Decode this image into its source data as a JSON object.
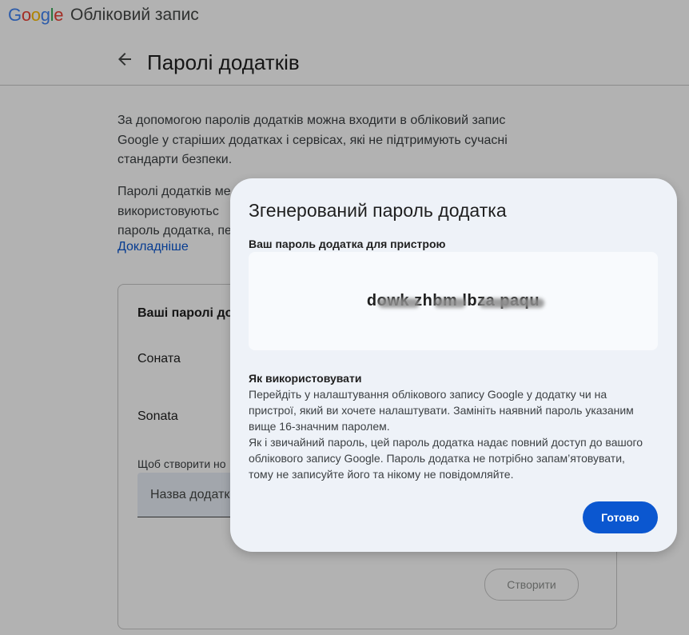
{
  "header": {
    "logo_letters": [
      "G",
      "o",
      "o",
      "g",
      "l",
      "e"
    ],
    "logo_colors": [
      "#4285f4",
      "#ea4335",
      "#fbbc05",
      "#4285f4",
      "#34a853",
      "#ea4335"
    ],
    "account_title": "Обліковий запис",
    "page_title": "Паролі додатків",
    "back_icon": "arrow-left-icon"
  },
  "intro": {
    "para1_lines": [
      "За допомогою паролів додатків можна входити в обліковий запис",
      "Google у старіших додатках і сервісах, які не підтримують сучасні",
      "стандарти безпеки."
    ],
    "para2_lines": [
      "Паролі додатків ме",
      "використовуютьс",
      "пароль додатка, пе"
    ],
    "learn_more": "Докладніше"
  },
  "card": {
    "title": "Ваші паролі до",
    "apps": [
      "Соната",
      "Sonata"
    ],
    "create_hint": "Щоб створити но",
    "name_placeholder": "Назва додатк",
    "create_button": "Створити"
  },
  "dialog": {
    "title": "Згенерований пароль додатка",
    "subtitle": "Ваш пароль додатка для пристрою",
    "password": "dowk zhbm lbza paqu",
    "how_title": "Як використовувати",
    "how_lines": [
      "Перейдіть у налаштування облікового запису Google у додатку чи на",
      "пристрої, який ви хочете налаштувати. Замініть наявний пароль указаним",
      "вище 16-значним паролем.",
      "Як і звичайний пароль, цей пароль додатка надає повний доступ до вашого",
      "облікового запису Google. Пароль додатка не потрібно запам’ятовувати,",
      "тому не записуйте його та нікому не повідомляйте."
    ],
    "done_button": "Готово"
  },
  "colors": {
    "accent": "#0b57d0",
    "dialog_bg": "#eef2f8",
    "scrim": "rgba(0,0,0,0.30)"
  }
}
